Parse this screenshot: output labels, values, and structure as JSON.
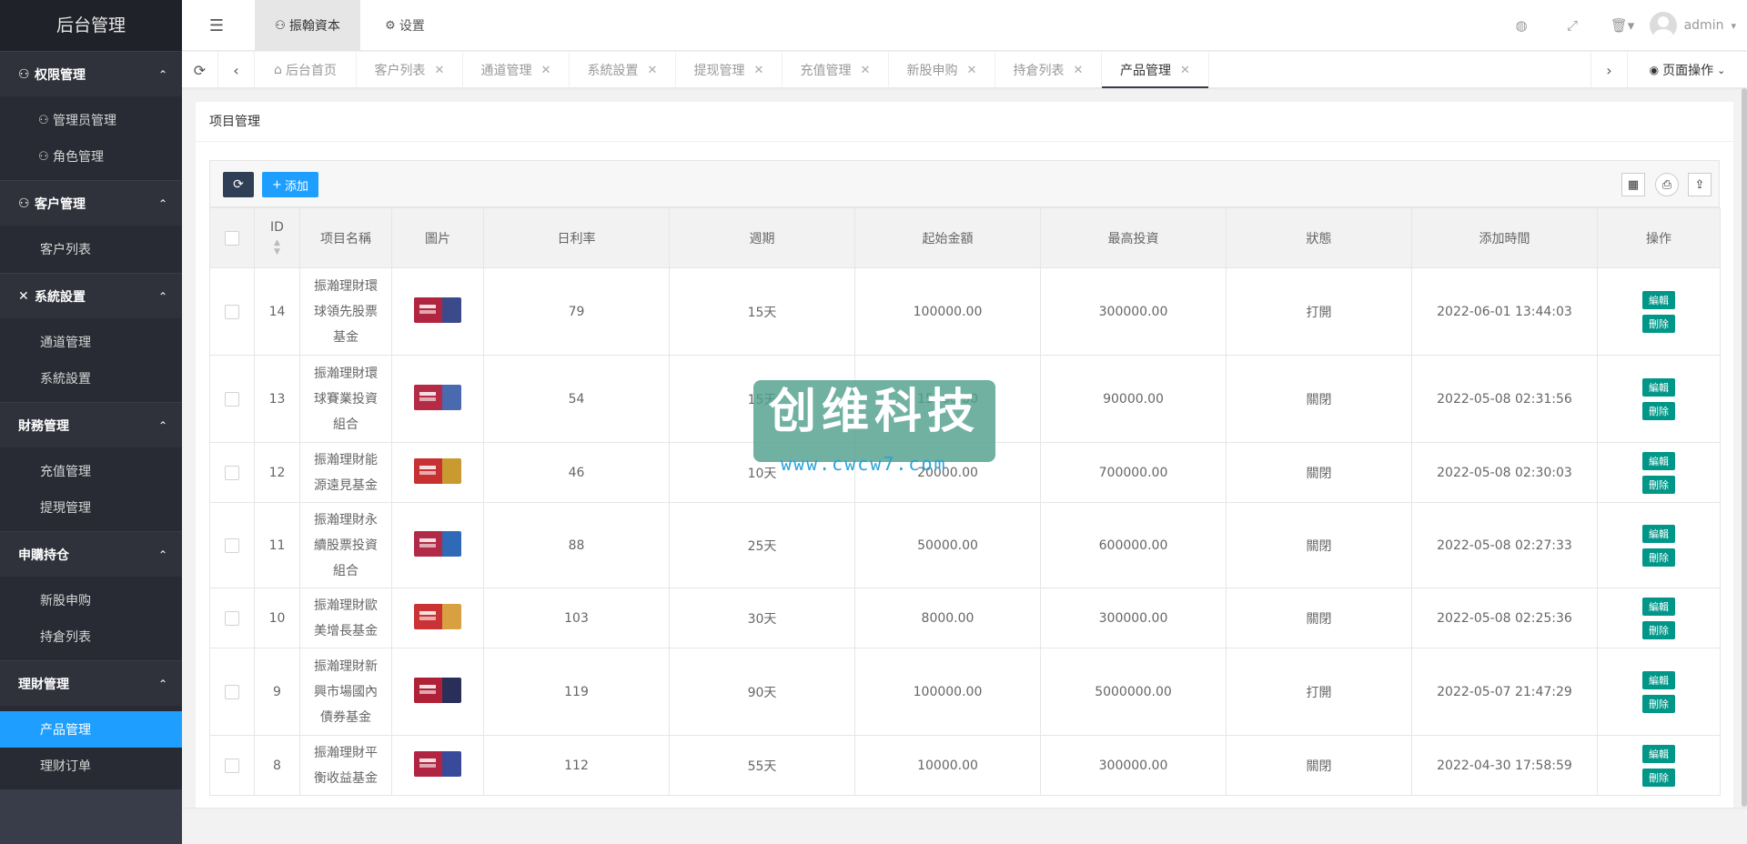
{
  "sidebar": {
    "logo": "后台管理",
    "groups": [
      {
        "label": "权限管理",
        "icon": "user-icon",
        "items": [
          {
            "label": "管理员管理",
            "icon": "user-icon"
          },
          {
            "label": "角色管理",
            "icon": "user-icon"
          }
        ]
      },
      {
        "label": "客户管理",
        "icon": "user-icon",
        "items": [
          {
            "label": "客户列表",
            "icon": ""
          }
        ]
      },
      {
        "label": "系統設置",
        "icon": "tools-icon",
        "items": [
          {
            "label": "通道管理",
            "icon": ""
          },
          {
            "label": "系統設置",
            "icon": ""
          }
        ]
      },
      {
        "label": "財務管理",
        "icon": "",
        "items": [
          {
            "label": "充值管理",
            "icon": ""
          },
          {
            "label": "提現管理",
            "icon": ""
          }
        ]
      },
      {
        "label": "申購持仓",
        "icon": "",
        "items": [
          {
            "label": "新股申购",
            "icon": ""
          },
          {
            "label": "持倉列表",
            "icon": ""
          }
        ]
      },
      {
        "label": "理財管理",
        "icon": "",
        "items": [
          {
            "label": "产品管理",
            "icon": "",
            "active": true
          },
          {
            "label": "理财订单",
            "icon": ""
          }
        ]
      }
    ]
  },
  "header": {
    "tab1": "振翰資本",
    "tab2": "设置",
    "user": "admin"
  },
  "tabbar": {
    "tabs": [
      {
        "label": "后台首页",
        "closable": false,
        "active": false
      },
      {
        "label": "客户列表",
        "closable": true,
        "active": false
      },
      {
        "label": "通道管理",
        "closable": true,
        "active": false
      },
      {
        "label": "系統設置",
        "closable": true,
        "active": false
      },
      {
        "label": "提现管理",
        "closable": true,
        "active": false
      },
      {
        "label": "充值管理",
        "closable": true,
        "active": false
      },
      {
        "label": "新股申购",
        "closable": true,
        "active": false
      },
      {
        "label": "持倉列表",
        "closable": true,
        "active": false
      },
      {
        "label": "产品管理",
        "closable": true,
        "active": true
      }
    ],
    "page_ops": "页面操作"
  },
  "card": {
    "title": "项目管理",
    "add_label": "添加"
  },
  "table": {
    "headers": [
      "ID",
      "项目名稱",
      "圖片",
      "日利率",
      "週期",
      "起始金額",
      "最高投資",
      "狀態",
      "添加時間",
      "操作"
    ],
    "edit_label": "編輯",
    "delete_label": "刪除",
    "rows": [
      {
        "id": "14",
        "name": [
          "振瀚理財環",
          "球領先股票",
          "基金"
        ],
        "rate": "79",
        "period": "15天",
        "min": "100000.00",
        "max": "300000.00",
        "status": "打開",
        "time": "2022-06-01 13:44:03",
        "img_color": "#3a4a8a"
      },
      {
        "id": "13",
        "name": [
          "振瀚理財環",
          "球賽業投資",
          "組合"
        ],
        "rate": "54",
        "period": "15天",
        "min": "15000.00",
        "max": "90000.00",
        "status": "關閉",
        "time": "2022-05-08 02:31:56",
        "img_color": "#4a6ab0"
      },
      {
        "id": "12",
        "name": [
          "振瀚理財能",
          "源遠見基金"
        ],
        "rate": "46",
        "period": "10天",
        "min": "20000.00",
        "max": "700000.00",
        "status": "關閉",
        "time": "2022-05-08 02:30:03",
        "img_color": "#c89a30"
      },
      {
        "id": "11",
        "name": [
          "振瀚理財永",
          "續股票投資",
          "組合"
        ],
        "rate": "88",
        "period": "25天",
        "min": "50000.00",
        "max": "600000.00",
        "status": "關閉",
        "time": "2022-05-08 02:27:33",
        "img_color": "#2f6ab8"
      },
      {
        "id": "10",
        "name": [
          "振瀚理財歐",
          "美增長基金"
        ],
        "rate": "103",
        "period": "30天",
        "min": "8000.00",
        "max": "300000.00",
        "status": "關閉",
        "time": "2022-05-08 02:25:36",
        "img_color": "#d8a040"
      },
      {
        "id": "9",
        "name": [
          "振瀚理財新",
          "興市場國內",
          "債券基金"
        ],
        "rate": "119",
        "period": "90天",
        "min": "100000.00",
        "max": "5000000.00",
        "status": "打開",
        "time": "2022-05-07 21:47:29",
        "img_color": "#2a2f5a"
      },
      {
        "id": "8",
        "name": [
          "振瀚理財平",
          "衡收益基金"
        ],
        "rate": "112",
        "period": "55天",
        "min": "10000.00",
        "max": "300000.00",
        "status": "關閉",
        "time": "2022-04-30 17:58:59",
        "img_color": "#3a4a9a"
      }
    ]
  },
  "watermark": {
    "title": "创维科技",
    "url": "www.cwcw7.com"
  },
  "colors": {
    "sidebar_bg": "#393d49",
    "active_blue": "#1e9fff",
    "op_green": "#009688",
    "tool_dark": "#2f4056"
  }
}
